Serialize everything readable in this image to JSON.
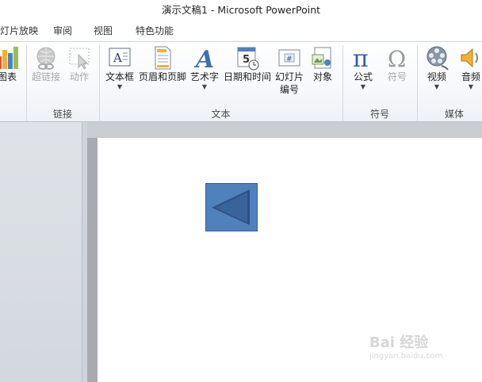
{
  "window": {
    "title": "演示文稿1  -  Microsoft PowerPoint"
  },
  "tabs": [
    {
      "label": "灯片放映"
    },
    {
      "label": "审阅"
    },
    {
      "label": "视图"
    },
    {
      "label": "特色功能"
    }
  ],
  "ribbon": {
    "chart_label": "图表",
    "hyperlink_label": "超链接",
    "action_label": "动作",
    "textbox_label": "文本框",
    "header_footer_label": "页眉和页脚",
    "wordart_label": "艺术字",
    "datetime_label": "日期和时间",
    "slide_number_label_1": "幻灯片",
    "slide_number_label_2": "编号",
    "object_label": "对象",
    "equation_label": "公式",
    "symbol_label": "符号",
    "video_label": "视频",
    "audio_label": "音频",
    "groups": {
      "links": "链接",
      "text": "文本",
      "symbols": "符号",
      "media": "媒体"
    }
  },
  "icons": {
    "chart": "bar-chart-icon",
    "hyperlink": "globe-link-icon",
    "action": "action-cursor-icon",
    "textbox": "textbox-icon",
    "header_footer": "header-footer-icon",
    "wordart": "wordart-icon",
    "datetime": "calendar-clock-icon",
    "slide_number": "slide-number-icon",
    "object": "object-icon",
    "equation": "pi-icon",
    "symbol": "omega-icon",
    "video": "film-reel-icon",
    "audio": "speaker-icon"
  },
  "colors": {
    "shape_fill": "#4f81bd",
    "shape_border": "#385d8a",
    "shape_arrow": "#2f5183"
  },
  "watermark": {
    "text": "Bai 经验",
    "sub": "jingyan.baidu.com"
  }
}
